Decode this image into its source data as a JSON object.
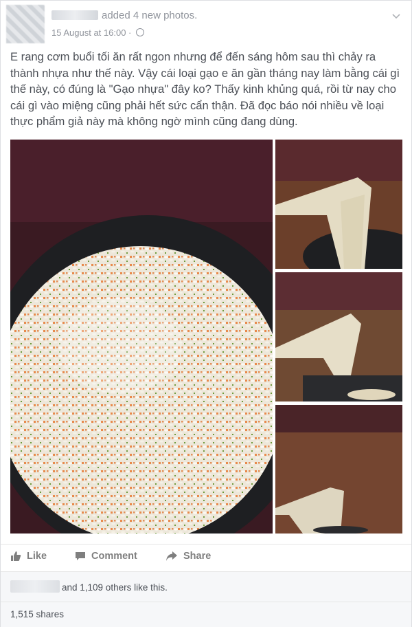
{
  "post": {
    "action_text": "added 4 new photos.",
    "timestamp": "15 August at 16:00 ·",
    "privacy_icon": "globe-icon",
    "text": "E rang cơm buổi tối ăn rất ngon nhưng để đến sáng hôm sau thì chảy ra thành nhựa như thế này. Vậy cái loại gạo e ăn gần tháng nay làm bằng cái gì thế này, có đúng là \"Gạo nhựa\" đây ko? Thấy kinh khủng quá, rồi từ nay cho cái gì vào miệng cũng phải hết sức cẩn thận. Đã đọc báo nói nhiều về loại thực phẩm giả này mà không ngờ mình cũng đang dùng."
  },
  "actions": {
    "like_label": "Like",
    "comment_label": "Comment",
    "share_label": "Share"
  },
  "stats": {
    "likes_text": "and 1,109 others like this.",
    "shares_text": "1,515 shares"
  },
  "colors": {
    "meta_gray": "#90949c",
    "text": "#4b4f56",
    "action_gray": "#7f7f7f"
  }
}
